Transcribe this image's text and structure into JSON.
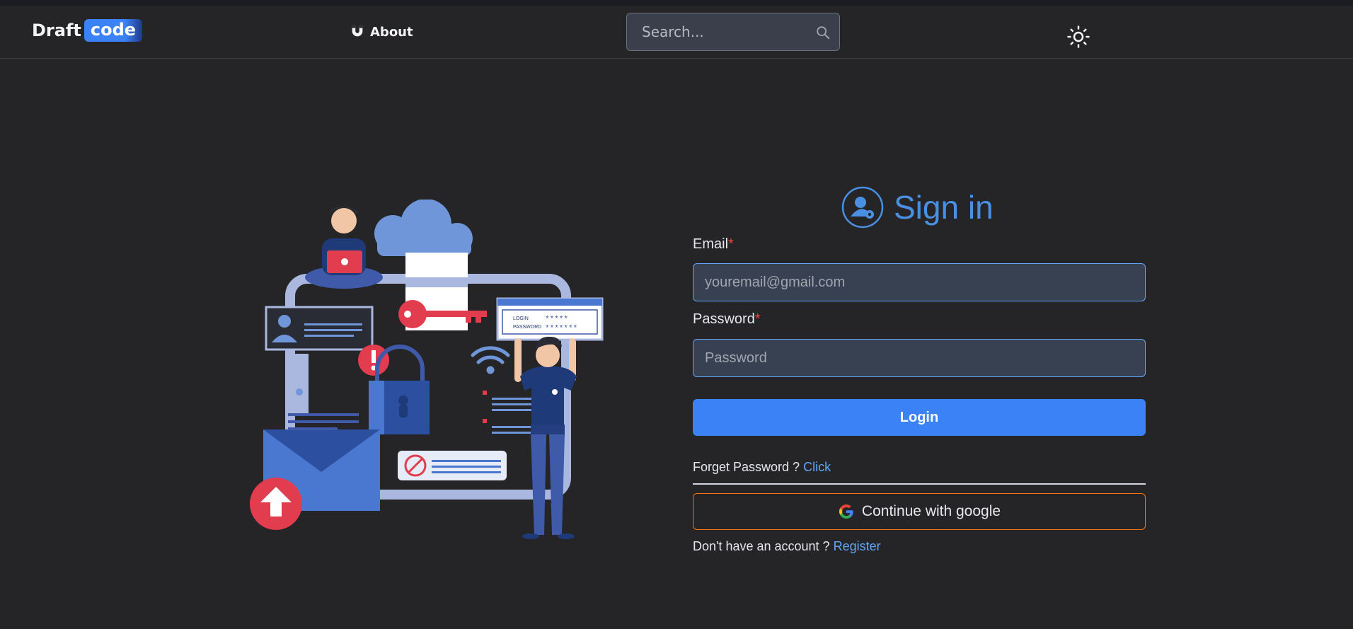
{
  "nav": {
    "logo_part1": "Draft",
    "logo_part2": "code",
    "about_label": "About",
    "search_placeholder": "Search...",
    "theme_icon": "sun-icon"
  },
  "signin": {
    "title": "Sign in",
    "title_icon": "user-gear-icon",
    "email_label": "Email",
    "email_placeholder": "youremail@gmail.com",
    "password_label": "Password",
    "password_placeholder": "Password",
    "required_mark": "*",
    "login_button": "Login",
    "forgot_text": "Forget Password ?",
    "forgot_link": "Click",
    "google_button": "Continue with google",
    "no_account_text": "Don't have an account ?",
    "register_link": "Register"
  },
  "illustration": {
    "login_label": "LOGIN",
    "login_mask": "*****",
    "password_label": "PASSWORD",
    "password_mask": "*******"
  },
  "colors": {
    "background": "#252528",
    "accent": "#3b82f6",
    "title_blue": "#4a90e2",
    "google_border": "#f97316",
    "required": "#ef4444"
  }
}
